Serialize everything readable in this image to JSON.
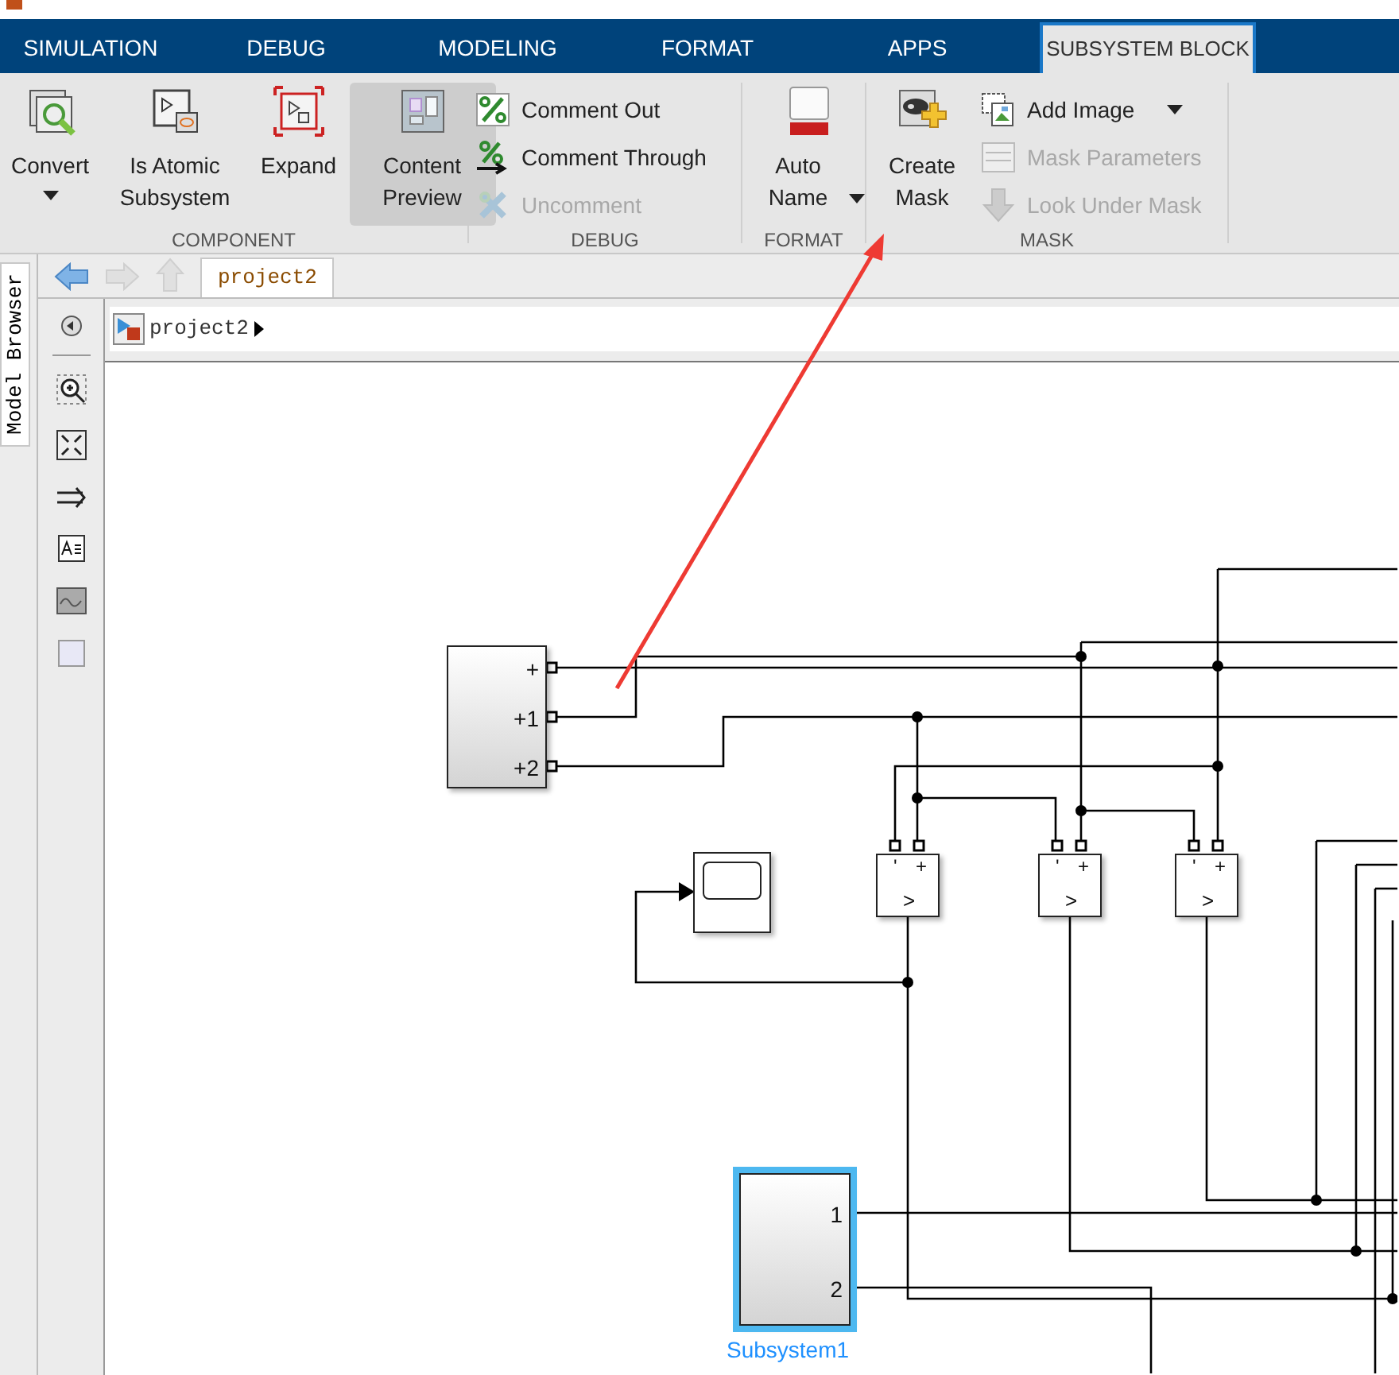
{
  "tabs": [
    {
      "label": "SIMULATION",
      "selected": false
    },
    {
      "label": "DEBUG",
      "selected": false
    },
    {
      "label": "MODELING",
      "selected": false
    },
    {
      "label": "FORMAT",
      "selected": false
    },
    {
      "label": "APPS",
      "selected": false
    },
    {
      "label": "SUBSYSTEM BLOCK",
      "selected": true
    }
  ],
  "ribbon": [
    {
      "label": "COMPONENT",
      "items": [
        {
          "label": "Convert",
          "kind": "large",
          "on": false,
          "dropdown": true
        },
        {
          "label": "Is Atomic Subsystem",
          "kind": "large",
          "on": false
        },
        {
          "label": "Expand",
          "kind": "large",
          "on": false
        },
        {
          "label": "Content Preview",
          "kind": "large",
          "on": true
        }
      ]
    },
    {
      "label": "DEBUG",
      "items": [
        {
          "label": "Comment Out",
          "kind": "small",
          "disabled": false
        },
        {
          "label": "Comment Through",
          "kind": "small",
          "disabled": false
        },
        {
          "label": "Uncomment",
          "kind": "small",
          "disabled": true
        }
      ]
    },
    {
      "label": "FORMAT",
      "items": [
        {
          "label": "Auto Name",
          "kind": "large",
          "on": false,
          "dropdown": true
        }
      ]
    },
    {
      "label": "MASK",
      "items": [
        {
          "label": "Create Mask",
          "kind": "large",
          "on": false
        },
        {
          "label": "Add Image",
          "kind": "small",
          "disabled": false,
          "dropdown": true
        },
        {
          "label": "Mask Parameters",
          "kind": "small",
          "disabled": true
        },
        {
          "label": "Look Under Mask",
          "kind": "small",
          "disabled": true
        }
      ]
    }
  ],
  "side_panel": {
    "tab": "Model Browser"
  },
  "editor": {
    "tab": "project2",
    "breadcrumb": "project2"
  },
  "diagram": {
    "blocks": [
      {
        "kind": "subsystem",
        "ports": [
          "+",
          "+1",
          "+2"
        ],
        "selected": false
      },
      {
        "kind": "scope"
      },
      {
        "kind": "comparator",
        "ports": [
          "'",
          "+"
        ],
        "symbol": ">"
      },
      {
        "kind": "comparator",
        "ports": [
          "'",
          "+"
        ],
        "symbol": ">"
      },
      {
        "kind": "comparator",
        "ports": [
          "'",
          "+"
        ],
        "symbol": ">"
      },
      {
        "kind": "subsystem",
        "ports": [
          "1",
          "2"
        ],
        "name": "Subsystem1",
        "selected": true
      }
    ]
  }
}
